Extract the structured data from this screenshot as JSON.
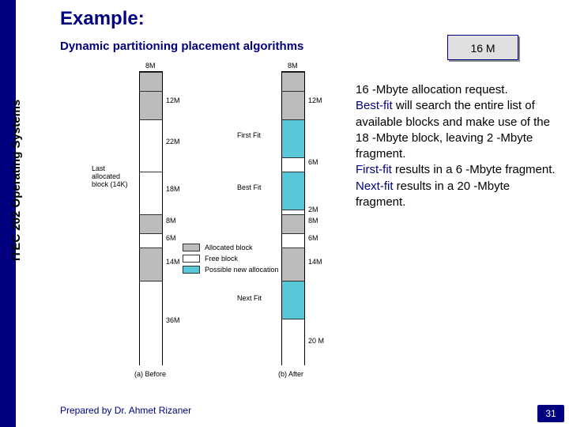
{
  "title": "Example:",
  "subtitle": "Dynamic partitioning placement algorithms",
  "vertical_label": "ITEC 202 Operating Systems",
  "footer": "Prepared by Dr. Ahmet Rizaner",
  "page_number": "31",
  "badge": "16  M",
  "body_text_parts": {
    "p1a": "16 -Mbyte allocation request.",
    "k1": "Best-fit",
    "p2": " will search the entire list of available blocks and make use of the 18 -Mbyte block, leaving 2 -Mbyte fragment.",
    "k2": "First-fit",
    "p3": " results in a 6 -Mbyte fragment.",
    "k3": "Next-fit",
    "p4": " results in a 20 -Mbyte fragment."
  },
  "legend": {
    "l1": "Allocated block",
    "l2": "Free block",
    "l3": "Possible new allocation"
  },
  "captions": {
    "before": "(a) Before",
    "after": "(b) After"
  },
  "arrows": {
    "last_allocated": "Last\nallocated\nblock (14K)",
    "first_fit": "First Fit",
    "best_fit": "Best Fit",
    "next_fit": "Next Fit"
  },
  "labels": {
    "a_top": "8M",
    "a1": "12M",
    "a2": "22M",
    "a3": "18M",
    "a4": "8M",
    "a5": "6M",
    "a6": "14M",
    "a7": "36M",
    "b_top": "8M",
    "b1": "12M",
    "b2": "6M",
    "b3": "2M",
    "b4": "8M",
    "b5": "6M",
    "b6": "14M",
    "b7": "20 M"
  },
  "chart_data": {
    "type": "bar",
    "title": "Dynamic partitioning memory map before and after 16M allocation",
    "before_blocks_M": [
      {
        "size": 8,
        "state": "allocated"
      },
      {
        "size": 12,
        "state": "allocated"
      },
      {
        "size": 22,
        "state": "free"
      },
      {
        "size": 18,
        "state": "free"
      },
      {
        "size": 8,
        "state": "allocated"
      },
      {
        "size": 6,
        "state": "free"
      },
      {
        "size": 14,
        "state": "allocated"
      },
      {
        "size": 36,
        "state": "free"
      }
    ],
    "after_blocks_M": [
      {
        "size": 8,
        "state": "allocated"
      },
      {
        "size": 12,
        "state": "allocated"
      },
      {
        "size": 16,
        "state": "new",
        "note": "First Fit"
      },
      {
        "size": 6,
        "state": "free"
      },
      {
        "size": 16,
        "state": "new",
        "note": "Best Fit"
      },
      {
        "size": 2,
        "state": "free"
      },
      {
        "size": 8,
        "state": "allocated"
      },
      {
        "size": 6,
        "state": "free"
      },
      {
        "size": 14,
        "state": "allocated"
      },
      {
        "size": 16,
        "state": "new",
        "note": "Next Fit"
      },
      {
        "size": 20,
        "state": "free"
      }
    ],
    "request_M": 16,
    "last_allocated_block_K": 14
  }
}
